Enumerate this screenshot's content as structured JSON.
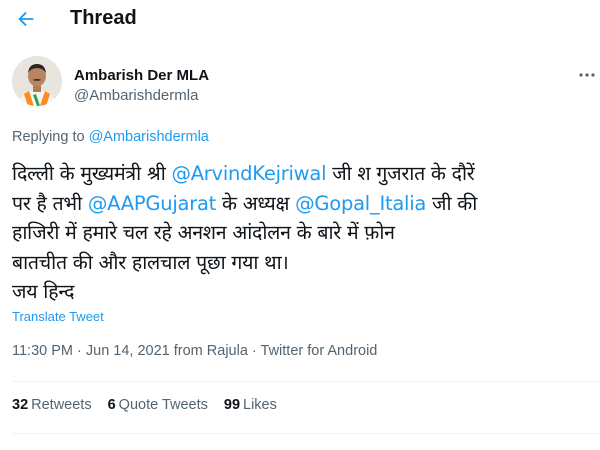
{
  "header": {
    "title": "Thread",
    "back_icon": "arrow-left-icon"
  },
  "author": {
    "display_name": "Ambarish Der MLA",
    "handle": "@Ambarishdermla",
    "avatar": "profile-photo",
    "more_icon": "more-horizontal-icon"
  },
  "replying": {
    "prefix": "Replying to",
    "handle": "@Ambarishdermla"
  },
  "tweet": {
    "segments": [
      [
        {
          "text": "दिल्ली के मुख्यमंत्री श्री ",
          "link": false
        },
        {
          "text": "@ArvindKejriwal",
          "link": true
        },
        {
          "text": " जी श गुजरात के दौरें",
          "link": false
        }
      ],
      [
        {
          "text": "पर है तभी ",
          "link": false
        },
        {
          "text": "@AAPGujarat",
          "link": true
        },
        {
          "text": " के अध्यक्ष ",
          "link": false
        },
        {
          "text": "@Gopal_Italia",
          "link": true
        },
        {
          "text": " जी की",
          "link": false
        }
      ],
      [
        {
          "text": "हाजिरी में हमारे चल रहे अनशन आंदोलन के बारे में फ़ोन",
          "link": false
        }
      ],
      [
        {
          "text": "बातचीत की और हालचाल पूछा गया था।",
          "link": false
        }
      ],
      [
        {
          "text": "जय हिन्द",
          "link": false
        }
      ]
    ],
    "translate_label": "Translate Tweet",
    "meta": "11:30 PM · Jun 14, 2021 from Rajula · Twitter for Android"
  },
  "stats": [
    {
      "num": "32",
      "label": "Retweets"
    },
    {
      "num": "6",
      "label": "Quote Tweets"
    },
    {
      "num": "99",
      "label": "Likes"
    }
  ],
  "colors": {
    "link": "#1d9bf0",
    "text": "#0f1419",
    "secondary": "#536471",
    "divider": "#eff3f4"
  }
}
